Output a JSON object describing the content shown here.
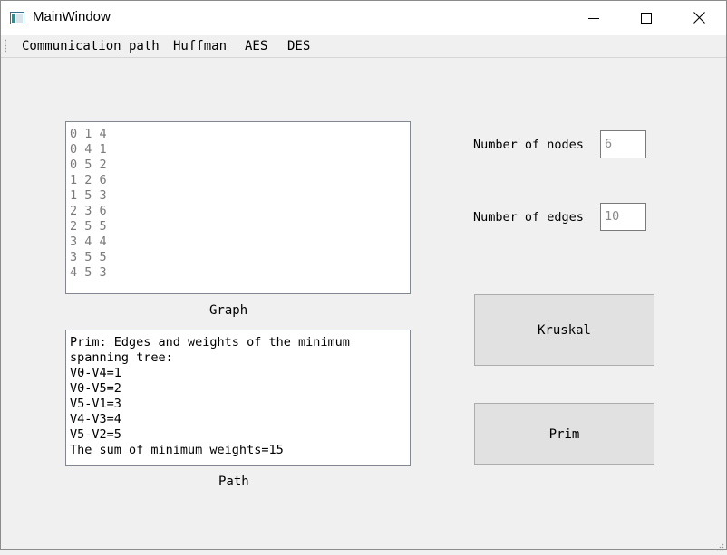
{
  "window": {
    "title": "MainWindow",
    "icons": {
      "app": "app-window-icon",
      "minimize": "minimize-icon",
      "maximize": "maximize-icon",
      "close": "close-icon"
    }
  },
  "menu": {
    "items": [
      {
        "label": "Communication_path"
      },
      {
        "label": "Huffman"
      },
      {
        "label": "AES"
      },
      {
        "label": "DES"
      }
    ]
  },
  "graph": {
    "text": "0 1 4\n0 4 1\n0 5 2\n1 2 6\n1 5 3\n2 3 6\n2 5 5\n3 4 4\n3 5 5\n4 5 3",
    "caption": "Graph"
  },
  "path": {
    "text": "Prim: Edges and weights of the minimum spanning tree:\nV0-V4=1\nV0-V5=2\nV5-V1=3\nV4-V3=4\nV5-V2=5\nThe sum of minimum weights=15",
    "caption": "Path"
  },
  "settings": {
    "nodes_label": "Number of nodes",
    "nodes_value": "6",
    "edges_label": "Number of edges",
    "edges_value": "10"
  },
  "buttons": {
    "kruskal": "Kruskal",
    "prim": "Prim"
  },
  "colors": {
    "window_bg": "#f0f0f0",
    "button_bg": "#e1e1e1",
    "placeholder_text": "#7a7a7a"
  }
}
